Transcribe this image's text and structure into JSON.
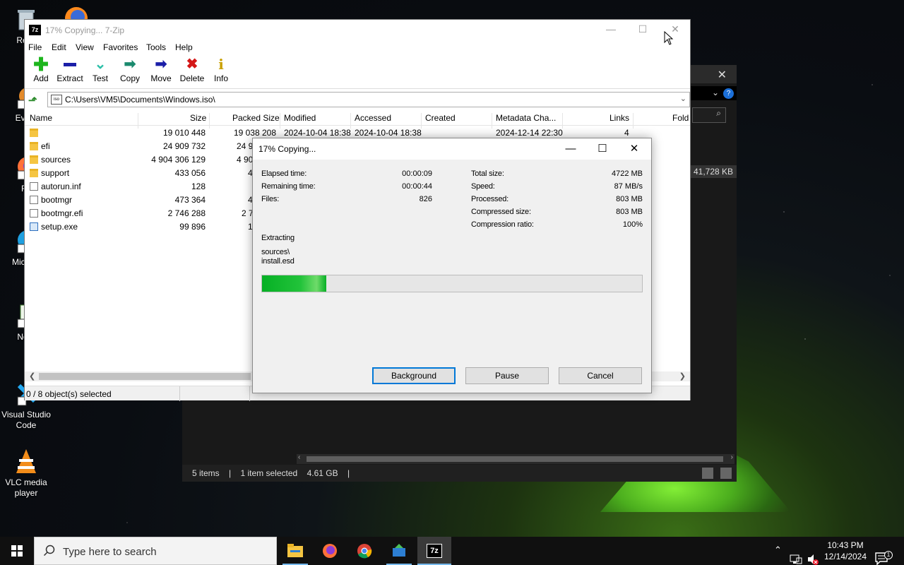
{
  "desktop": {
    "icons": [
      {
        "label": "Recy",
        "name": "recycle-bin"
      },
      {
        "label": "Every",
        "name": "everything"
      },
      {
        "label": "Fir",
        "name": "firefox"
      },
      {
        "label": "Micr Ec",
        "name": "microsoft-edge"
      },
      {
        "label": "Note",
        "name": "notepad"
      },
      {
        "label": "Visual Studio Code",
        "name": "vscode"
      },
      {
        "label": "VLC media player",
        "name": "vlc"
      }
    ]
  },
  "explorer": {
    "info_size": "41,728 KB",
    "status": {
      "items": "5 items",
      "selected": "1 item selected",
      "size": "4.61 GB"
    }
  },
  "zip": {
    "title": "17% Copying... 7-Zip",
    "logo": "7z",
    "menu": [
      "File",
      "Edit",
      "View",
      "Favorites",
      "Tools",
      "Help"
    ],
    "toolbar": {
      "add": "Add",
      "extract": "Extract",
      "test": "Test",
      "copy": "Copy",
      "move": "Move",
      "delete": "Delete",
      "info": "Info"
    },
    "path": "C:\\Users\\VM5\\Documents\\Windows.iso\\",
    "columns": {
      "name": "Name",
      "size": "Size",
      "packed": "Packed Size",
      "modified": "Modified",
      "accessed": "Accessed",
      "created": "Created",
      "metadata": "Metadata Cha...",
      "links": "Links",
      "folder": "Fold"
    },
    "rows": [
      {
        "name": "",
        "size": "19 010 448",
        "packed": "19 038 208",
        "modified": "2024-10-04 18:38",
        "accessed": "2024-10-04 18:38",
        "metadata": "2024-12-14 22:30",
        "links": "4",
        "type": "folder"
      },
      {
        "name": "efi",
        "size": "24 909 732",
        "packed": "24 9",
        "type": "folder"
      },
      {
        "name": "sources",
        "size": "4 904 306 129",
        "packed": "4 905 0",
        "type": "folder"
      },
      {
        "name": "support",
        "size": "433 056",
        "packed": "4",
        "type": "folder"
      },
      {
        "name": "autorun.inf",
        "size": "128",
        "packed": "",
        "type": "file-inf"
      },
      {
        "name": "bootmgr",
        "size": "473 364",
        "packed": "4",
        "type": "file"
      },
      {
        "name": "bootmgr.efi",
        "size": "2 746 288",
        "packed": "2 7",
        "type": "file"
      },
      {
        "name": "setup.exe",
        "size": "99 896",
        "packed": "1",
        "type": "exe"
      }
    ],
    "status": "0 / 8 object(s) selected"
  },
  "dialog": {
    "title": "17% Copying...",
    "left": [
      {
        "label": "Elapsed time:",
        "value": "00:00:09"
      },
      {
        "label": "Remaining time:",
        "value": "00:00:44"
      },
      {
        "label": "Files:",
        "value": "826"
      }
    ],
    "right": [
      {
        "label": "Total size:",
        "value": "4722 MB"
      },
      {
        "label": "Speed:",
        "value": "87 MB/s"
      },
      {
        "label": "Processed:",
        "value": "803 MB"
      },
      {
        "label": "Compressed size:",
        "value": "803 MB"
      },
      {
        "label": "Compression ratio:",
        "value": "100%"
      }
    ],
    "action": "Extracting",
    "current_dir": "sources\\",
    "current_file": "install.esd",
    "progress_fraction": 0.17,
    "buttons": {
      "background": "Background",
      "pause": "Pause",
      "cancel": "Cancel"
    }
  },
  "taskbar": {
    "search_placeholder": "Type here to search",
    "time": "10:43 PM",
    "date": "12/14/2024",
    "notification_count": "1",
    "accent": "#76b9ed"
  }
}
